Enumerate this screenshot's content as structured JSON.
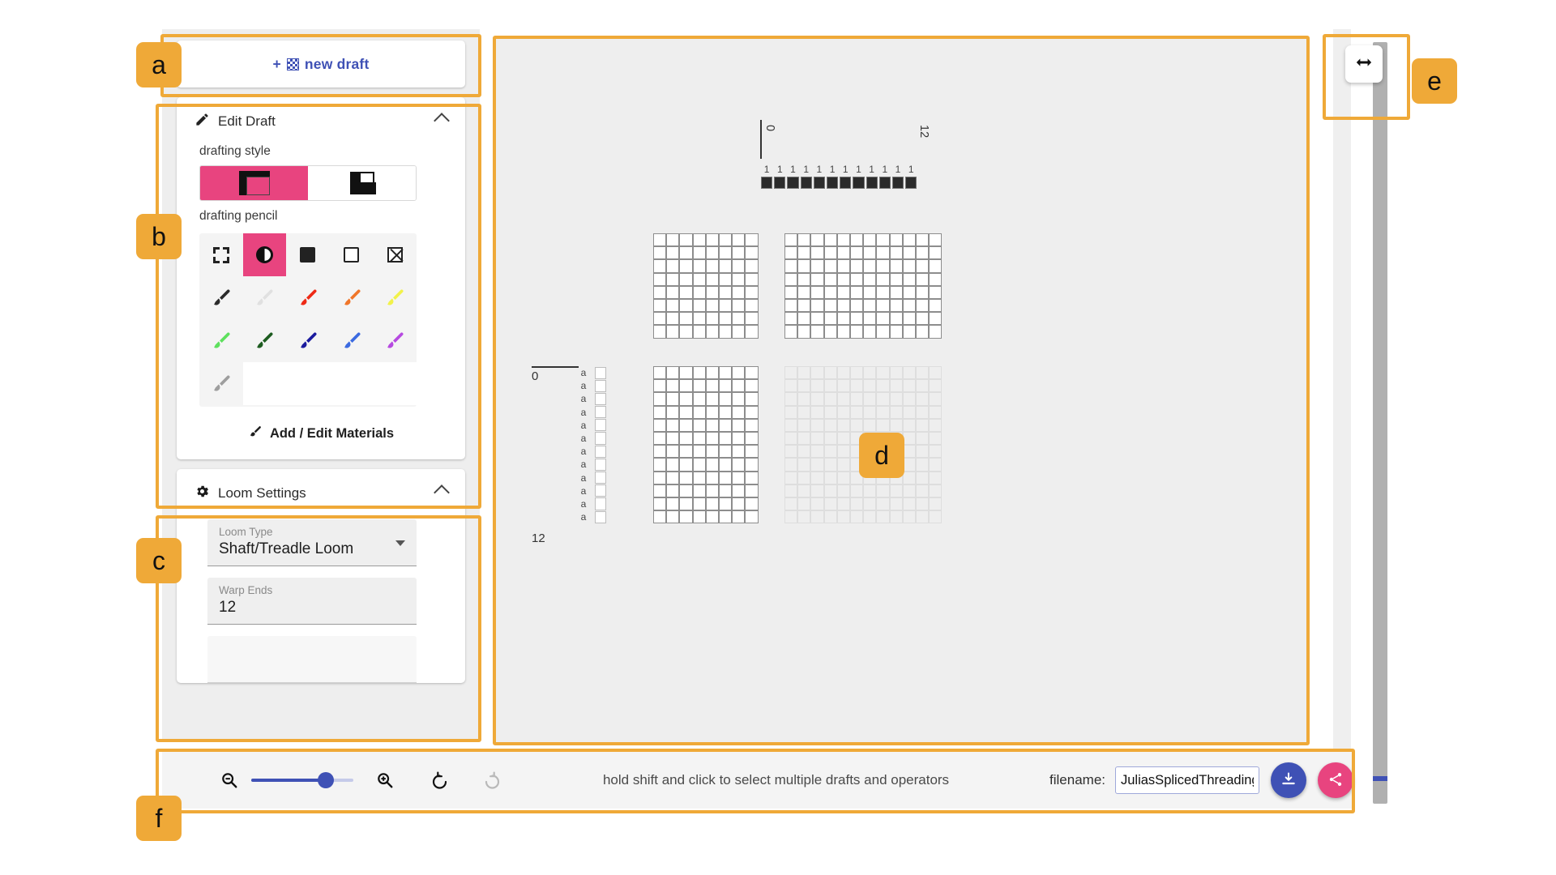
{
  "sidebar": {
    "new_draft": {
      "label": "new draft",
      "plus": "+",
      "icon": "draft-grid-icon"
    },
    "edit_draft": {
      "title": "Edit Draft",
      "icon": "edit-pencil-icon",
      "collapse_icon": "chevron-up-icon",
      "drafting_style_label": "drafting style",
      "drafting_style_options": [
        "style-corner-block",
        "style-split-block"
      ],
      "drafting_style_selected_index": 0,
      "drafting_pencil_label": "drafting pencil",
      "pencil_tools": [
        {
          "name": "select-region-icon",
          "selected": false
        },
        {
          "name": "toggle-heddle-icon",
          "selected": true
        },
        {
          "name": "filled-square-icon",
          "selected": false
        },
        {
          "name": "empty-square-icon",
          "selected": false
        },
        {
          "name": "clear-square-icon",
          "selected": false
        }
      ],
      "material_brushes": [
        {
          "name": "brush-black",
          "color": "#2b2b2b"
        },
        {
          "name": "brush-white",
          "color": "#ffffff"
        },
        {
          "name": "brush-red",
          "color": "#ee2a16"
        },
        {
          "name": "brush-orange",
          "color": "#f0762a"
        },
        {
          "name": "brush-yellow",
          "color": "#f2f24a"
        },
        {
          "name": "brush-light-green",
          "color": "#5ee05e"
        },
        {
          "name": "brush-dark-green",
          "color": "#1d5c20"
        },
        {
          "name": "brush-navy",
          "color": "#1b1b9e"
        },
        {
          "name": "brush-blue",
          "color": "#3b6ae0"
        },
        {
          "name": "brush-purple",
          "color": "#b64ae0"
        },
        {
          "name": "brush-gray",
          "color": "#9e9e9e"
        }
      ],
      "add_edit_materials": "Add / Edit Materials"
    },
    "loom_settings": {
      "title": "Loom Settings",
      "icon": "gear-icon",
      "collapse_icon": "chevron-up-icon",
      "fields": [
        {
          "label": "Loom Type",
          "value": "Shaft/Treadle Loom",
          "has_caret": true
        },
        {
          "label": "Warp Ends",
          "value": "12",
          "has_caret": false
        }
      ]
    }
  },
  "canvas": {
    "top_ruler": {
      "start": "0",
      "end": "12",
      "cell_labels": [
        "1",
        "1",
        "1",
        "1",
        "1",
        "1",
        "1",
        "1",
        "1",
        "1",
        "1",
        "1"
      ]
    },
    "left_ruler": {
      "start": "0",
      "end": "12",
      "row_labels": [
        "a",
        "a",
        "a",
        "a",
        "a",
        "a",
        "a",
        "a",
        "a",
        "a",
        "a",
        "a"
      ]
    },
    "grids": [
      {
        "name": "tieup-grid",
        "cols": 8,
        "rows": 8,
        "faint": false
      },
      {
        "name": "threading-grid",
        "cols": 12,
        "rows": 8,
        "faint": false
      },
      {
        "name": "treadling-grid",
        "cols": 8,
        "rows": 12,
        "faint": false
      },
      {
        "name": "drawdown-grid",
        "cols": 12,
        "rows": 12,
        "faint": true
      }
    ]
  },
  "toolbar": {
    "zoom_out_icon": "zoom-out-icon",
    "zoom_in_icon": "zoom-in-icon",
    "undo_icon": "undo-icon",
    "redo_icon": "redo-icon",
    "zoom_value": 65,
    "hint": "hold shift and click to select multiple drafts and operators",
    "filename_label": "filename:",
    "filename_value": "JuliasSplicedThreading",
    "download_icon": "download-icon",
    "share_icon": "share-icon",
    "accent_indigo": "#3f51b5",
    "accent_pink": "#e8447f"
  },
  "right_panel": {
    "resize_icon": "resize-horizontal-icon",
    "scrollbar": "vertical-scrollbar"
  },
  "annotations": [
    {
      "tag": "a"
    },
    {
      "tag": "b"
    },
    {
      "tag": "c"
    },
    {
      "tag": "d"
    },
    {
      "tag": "e"
    },
    {
      "tag": "f"
    }
  ]
}
